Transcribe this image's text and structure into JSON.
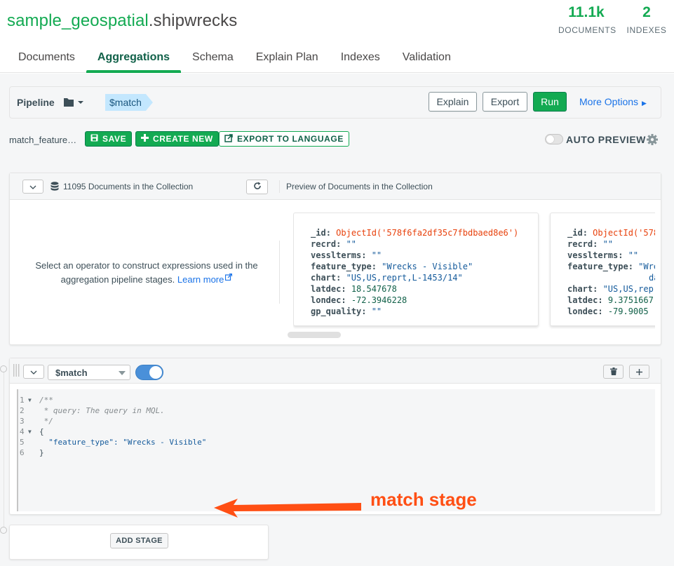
{
  "namespace": {
    "db": "sample_geospatial",
    "collection": ".shipwrecks"
  },
  "stats": [
    {
      "value": "11.1k",
      "label": "DOCUMENTS"
    },
    {
      "value": "2",
      "label": "INDEXES"
    }
  ],
  "tabs": [
    {
      "label": "Documents",
      "active": false
    },
    {
      "label": "Aggregations",
      "active": true
    },
    {
      "label": "Schema",
      "active": false
    },
    {
      "label": "Explain Plan",
      "active": false
    },
    {
      "label": "Indexes",
      "active": false
    },
    {
      "label": "Validation",
      "active": false
    }
  ],
  "toolbar": {
    "pipeline_label": "Pipeline",
    "stage_pill": "$match",
    "explain": "Explain",
    "export": "Export",
    "run": "Run",
    "more_options": "More Options"
  },
  "pipeline_name": {
    "name": "match_feature…",
    "save": "SAVE",
    "create_new": "CREATE NEW",
    "export_to_language": "EXPORT TO LANGUAGE",
    "auto_preview": "AUTO PREVIEW"
  },
  "collection_panel": {
    "count_text": "11095 Documents in the Collection",
    "preview_text": "Preview of Documents in the Collection",
    "hint": "Select an operator to construct expressions used in the aggregation pipeline stages.",
    "learn_more": "Learn more",
    "docs": [
      {
        "fields": [
          {
            "key": "_id",
            "value": "ObjectId('578f6fa2df35c7fbdbaed8e6')",
            "kind": "oid"
          },
          {
            "key": "recrd",
            "value": "\"\"",
            "kind": "str"
          },
          {
            "key": "vesslterms",
            "value": "\"\"",
            "kind": "str"
          },
          {
            "key": "feature_type",
            "value": "\"Wrecks - Visible\"",
            "kind": "str"
          },
          {
            "key": "chart",
            "value": "\"US,US,reprt,L-1453/14\"",
            "kind": "str"
          },
          {
            "key": "latdec",
            "value": "18.547678",
            "kind": "num"
          },
          {
            "key": "londec",
            "value": "-72.3946228",
            "kind": "num"
          },
          {
            "key": "gp_quality",
            "value": "\"\"",
            "kind": "str"
          }
        ]
      },
      {
        "fields": [
          {
            "key": "_id",
            "value": "ObjectId('578",
            "kind": "oid"
          },
          {
            "key": "recrd",
            "value": "\"\"",
            "kind": "str"
          },
          {
            "key": "vesslterms",
            "value": "\"\"",
            "kind": "str"
          },
          {
            "key": "feature_type",
            "value": "\"Wre",
            "kind": "str"
          },
          {
            "key": "",
            "value": "dang",
            "kind": "str"
          },
          {
            "key": "chart",
            "value": "\"US,US,rep",
            "kind": "str"
          },
          {
            "key": "latdec",
            "value": "9.3751667",
            "kind": "num"
          },
          {
            "key": "londec",
            "value": "-79.9005",
            "kind": "num"
          }
        ]
      }
    ]
  },
  "stage": {
    "operator": "$match",
    "enabled": true,
    "code_lines": [
      {
        "num": "1",
        "fold": true,
        "text": "/**",
        "kind": "comment"
      },
      {
        "num": "2",
        "fold": false,
        "text": " * query: The query in MQL.",
        "kind": "comment"
      },
      {
        "num": "3",
        "fold": false,
        "text": " */",
        "kind": "comment"
      },
      {
        "num": "4",
        "fold": true,
        "text": "{",
        "kind": "brace"
      },
      {
        "num": "5",
        "fold": false,
        "text": "  \"feature_type\": \"Wrecks - Visible\"",
        "kind": "kv"
      },
      {
        "num": "6",
        "fold": false,
        "text": "}",
        "kind": "brace"
      }
    ]
  },
  "annotation": {
    "text": "match stage",
    "color": "#ff4f14"
  },
  "add_stage": "ADD STAGE",
  "colors": {
    "accent": "#13aa52",
    "link": "#1a73e8",
    "pill": "#c3e7fe"
  }
}
